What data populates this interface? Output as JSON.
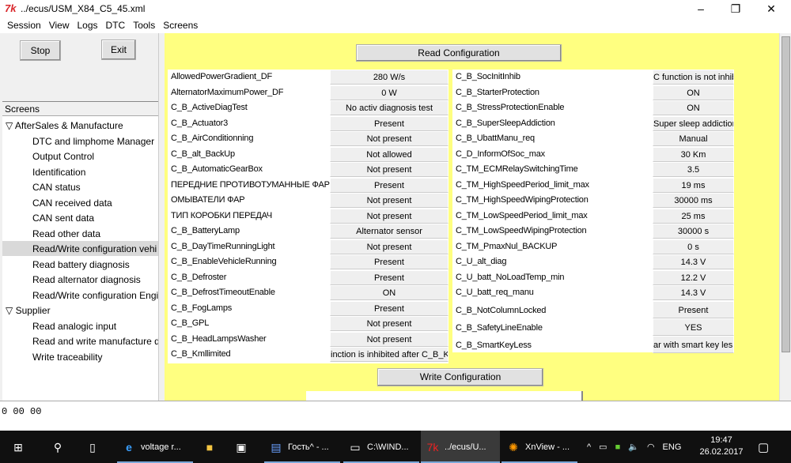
{
  "window": {
    "title": "../ecus/USM_X84_C5_45.xml",
    "logo": "7k",
    "minimize": "–",
    "maximize": "❐",
    "close": "✕"
  },
  "menu": [
    "Session",
    "View",
    "Logs",
    "DTC",
    "Tools",
    "Screens"
  ],
  "left": {
    "stop": "Stop",
    "exit": "Exit",
    "tree_header": "Screens",
    "tree": [
      {
        "label": "AfterSales & Manufacture",
        "level": 0,
        "expanded": true
      },
      {
        "label": "DTC and limphome Manager",
        "level": 1
      },
      {
        "label": "Output Control",
        "level": 1
      },
      {
        "label": "Identification",
        "level": 1
      },
      {
        "label": "CAN status",
        "level": 1
      },
      {
        "label": "CAN received data",
        "level": 1
      },
      {
        "label": "CAN sent data",
        "level": 1
      },
      {
        "label": "Read other data",
        "level": 1
      },
      {
        "label": "Read/Write configuration vehi",
        "level": 1,
        "selected": true
      },
      {
        "label": "Read battery diagnosis",
        "level": 1
      },
      {
        "label": "Read alternator diagnosis",
        "level": 1
      },
      {
        "label": "Read/Write configuration Engi",
        "level": 1
      },
      {
        "label": "Supplier",
        "level": 0,
        "expanded": true
      },
      {
        "label": "Read analogic input",
        "level": 1
      },
      {
        "label": "Read and write manufacture d",
        "level": 1
      },
      {
        "label": "Write traceability",
        "level": 1
      }
    ]
  },
  "content": {
    "read_button": "Read Configuration",
    "write_button": "Write Configuration",
    "left_table": [
      [
        "AllowedPowerGradient_DF",
        "280 W/s"
      ],
      [
        "AlternatorMaximumPower_DF",
        "0 W"
      ],
      [
        "C_B_ActiveDiagTest",
        "No activ diagnosis test"
      ],
      [
        "C_B_Actuator3",
        "Present"
      ],
      [
        "C_B_AirConditionning",
        "Not present"
      ],
      [
        "C_B_alt_BackUp",
        "Not allowed"
      ],
      [
        "C_B_AutomaticGearBox",
        "Not present"
      ],
      [
        "ПЕРЕДНИЕ ПРОТИВОТУМАННЫЕ ФАРЫ",
        "Present"
      ],
      [
        "ОМЫВАТЕЛИ ФАР",
        "Not present"
      ],
      [
        "ТИП КОРОБКИ ПЕРЕДАЧ",
        "Not present"
      ],
      [
        "C_B_BatteryLamp",
        "Alternator sensor"
      ],
      [
        "C_B_DayTimeRunningLight",
        "Not present"
      ],
      [
        "C_B_EnableVehicleRunning",
        "Present"
      ],
      [
        "C_B_Defroster",
        "Present"
      ],
      [
        "C_B_DefrostTimeoutEnable",
        "ON"
      ],
      [
        "C_B_FogLamps",
        "Present"
      ],
      [
        "C_B_GPL",
        "Not present"
      ],
      [
        "C_B_HeadLampsWasher",
        "Not present"
      ],
      [
        "C_B_Kmllimited",
        "inction is inhibited after C_B_Km"
      ]
    ],
    "right_table": [
      [
        "C_B_SocInitInhib",
        "C function is not inhibi"
      ],
      [
        "C_B_StarterProtection",
        "ON"
      ],
      [
        "C_B_StressProtectionEnable",
        "ON"
      ],
      [
        "C_B_SuperSleepAddiction",
        "Super sleep addiction"
      ],
      [
        "C_B_UbattManu_req",
        "Manual"
      ],
      [
        "C_D_InformOfSoc_max",
        "30 Km"
      ],
      [
        "C_TM_ECMRelaySwitchingTime",
        "3.5"
      ],
      [
        "C_TM_HighSpeedPeriod_limit_max",
        "19 ms"
      ],
      [
        "C_TM_HighSpeedWipingProtection",
        "30000 ms"
      ],
      [
        "C_TM_LowSpeedPeriod_limit_max",
        "25 ms"
      ],
      [
        "C_TM_LowSpeedWipingProtection",
        "30000 s"
      ],
      [
        "C_TM_PmaxNul_BACKUP",
        "0 s"
      ],
      [
        "C_U_alt_diag",
        "14.3 V"
      ],
      [
        "C_U_batt_NoLoadTemp_min",
        "12.2 V"
      ],
      [
        "C_U_batt_req_manu",
        "14.3 V"
      ],
      [
        "C_B_NotColumnLocked",
        "Present"
      ],
      [
        "C_B_SafetyLineEnable",
        "YES"
      ],
      [
        "C_B_SmartKeyLess",
        "ar with smart key les:"
      ]
    ]
  },
  "bottom": {
    "text": "0 00 00"
  },
  "taskbar": {
    "items": [
      "voltage r...",
      "Гость^ - ...",
      "C:\\WIND...",
      "../ecus/U...",
      "XnView - ..."
    ],
    "lang": "ENG",
    "time": "19:47",
    "date": "26.02.2017"
  }
}
